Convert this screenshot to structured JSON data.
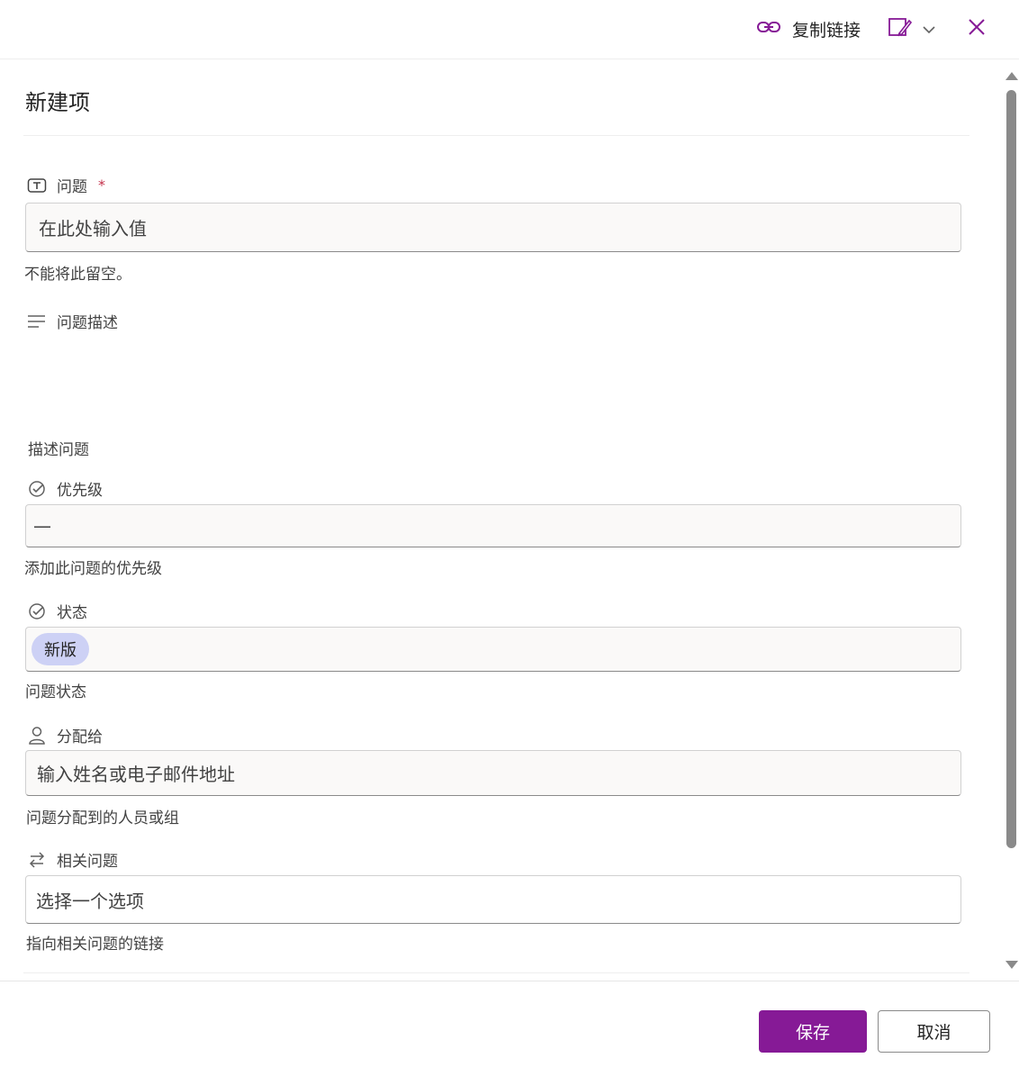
{
  "header": {
    "copy_link_label": "复制链接",
    "icons": {
      "copy_link": "link-icon",
      "edit_view": "edit-form-icon",
      "chevron": "chevron-down-icon",
      "close": "close-icon"
    }
  },
  "form": {
    "title": "新建项",
    "fields": [
      {
        "key": "issue",
        "label": "问题",
        "required_mark": "*",
        "icon": "text-field-icon",
        "placeholder": "在此处输入值",
        "helper": "不能将此留空。"
      },
      {
        "key": "description",
        "label": "问题描述",
        "icon": "multiline-text-icon",
        "helper": "描述问题"
      },
      {
        "key": "priority",
        "label": "优先级",
        "icon": "choice-check-icon",
        "value": "—",
        "helper": "添加此问题的优先级"
      },
      {
        "key": "status",
        "label": "状态",
        "icon": "choice-check-icon",
        "value": "新版",
        "helper": "问题状态"
      },
      {
        "key": "assigned_to",
        "label": "分配给",
        "icon": "person-icon",
        "placeholder": "输入姓名或电子邮件地址",
        "helper": "问题分配到的人员或组"
      },
      {
        "key": "related",
        "label": "相关问题",
        "icon": "arrow-swap-icon",
        "placeholder": "选择一个选项",
        "helper": "指向相关问题的链接"
      }
    ]
  },
  "footer": {
    "save_label": "保存",
    "cancel_label": "取消"
  },
  "colors": {
    "accent": "#861a96",
    "status_pill": "#cdd1f5",
    "required": "#c4314b"
  }
}
